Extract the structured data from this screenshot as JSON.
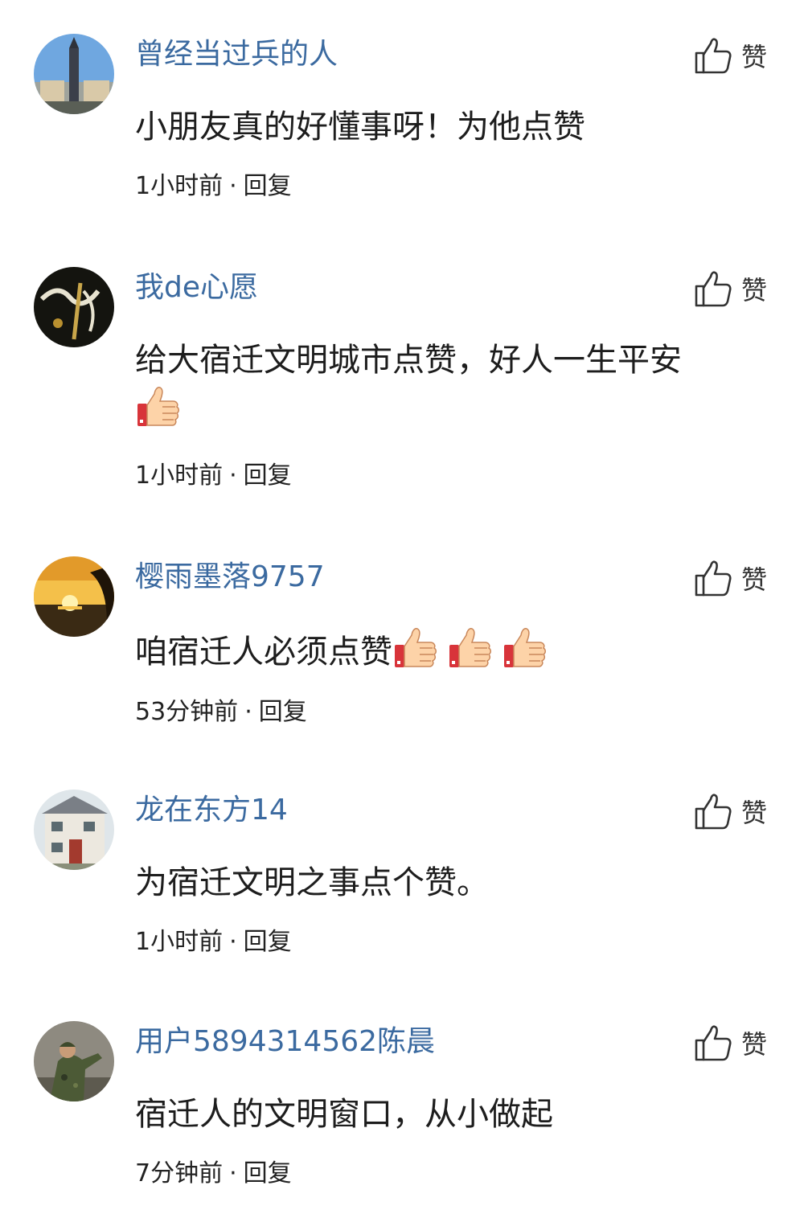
{
  "like_label": "赞",
  "reply_label": "回复",
  "separator": "·",
  "comments": [
    {
      "username": "曾经当过兵的人",
      "text": "小朋友真的好懂事呀！为他点赞",
      "time": "1小时前",
      "avatar_icon": "building-tower-avatar",
      "emoji_count": 0
    },
    {
      "username": "我de心愿",
      "text": "给大宿迁文明城市点赞，好人一生平安",
      "time": "1小时前",
      "avatar_icon": "dark-calligraphy-avatar",
      "emoji_count": 1
    },
    {
      "username": "樱雨墨落9757",
      "text": "咱宿迁人必须点赞",
      "time": "53分钟前",
      "avatar_icon": "sunset-avatar",
      "emoji_count": 3
    },
    {
      "username": "龙在东方14",
      "text": "为宿迁文明之事点个赞。",
      "time": "1小时前",
      "avatar_icon": "house-avatar",
      "emoji_count": 0
    },
    {
      "username": "用户5894314562陈晨",
      "text": "宿迁人的文明窗口，从小做起",
      "time": "7分钟前",
      "avatar_icon": "soldier-avatar",
      "emoji_count": 0
    }
  ],
  "colors": {
    "username": "#3b6aa0",
    "text": "#1d1d1d",
    "background": "#ffffff"
  }
}
